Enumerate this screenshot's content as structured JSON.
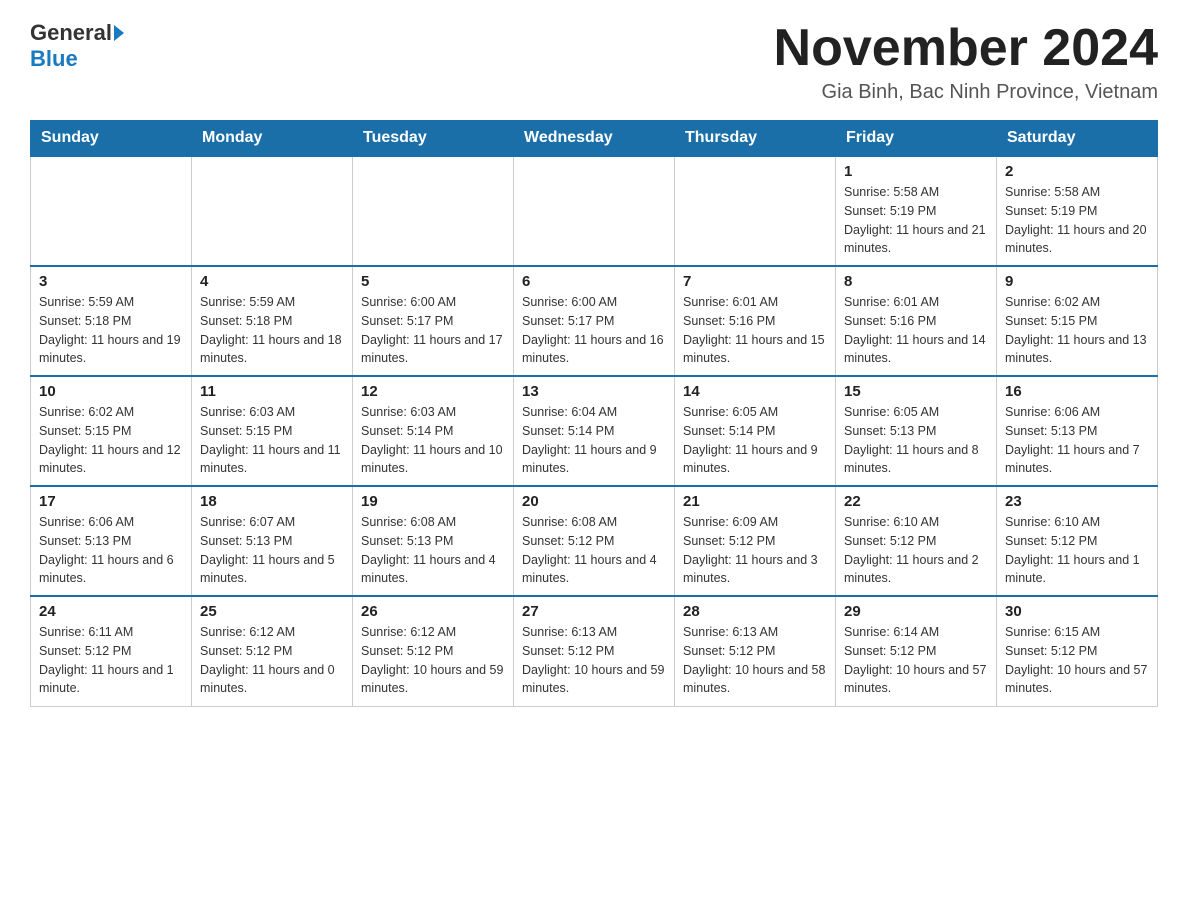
{
  "header": {
    "logo_general": "General",
    "logo_blue": "Blue",
    "month_title": "November 2024",
    "location": "Gia Binh, Bac Ninh Province, Vietnam"
  },
  "days_of_week": [
    "Sunday",
    "Monday",
    "Tuesday",
    "Wednesday",
    "Thursday",
    "Friday",
    "Saturday"
  ],
  "weeks": [
    {
      "days": [
        {
          "number": "",
          "info": ""
        },
        {
          "number": "",
          "info": ""
        },
        {
          "number": "",
          "info": ""
        },
        {
          "number": "",
          "info": ""
        },
        {
          "number": "",
          "info": ""
        },
        {
          "number": "1",
          "info": "Sunrise: 5:58 AM\nSunset: 5:19 PM\nDaylight: 11 hours and 21 minutes."
        },
        {
          "number": "2",
          "info": "Sunrise: 5:58 AM\nSunset: 5:19 PM\nDaylight: 11 hours and 20 minutes."
        }
      ]
    },
    {
      "days": [
        {
          "number": "3",
          "info": "Sunrise: 5:59 AM\nSunset: 5:18 PM\nDaylight: 11 hours and 19 minutes."
        },
        {
          "number": "4",
          "info": "Sunrise: 5:59 AM\nSunset: 5:18 PM\nDaylight: 11 hours and 18 minutes."
        },
        {
          "number": "5",
          "info": "Sunrise: 6:00 AM\nSunset: 5:17 PM\nDaylight: 11 hours and 17 minutes."
        },
        {
          "number": "6",
          "info": "Sunrise: 6:00 AM\nSunset: 5:17 PM\nDaylight: 11 hours and 16 minutes."
        },
        {
          "number": "7",
          "info": "Sunrise: 6:01 AM\nSunset: 5:16 PM\nDaylight: 11 hours and 15 minutes."
        },
        {
          "number": "8",
          "info": "Sunrise: 6:01 AM\nSunset: 5:16 PM\nDaylight: 11 hours and 14 minutes."
        },
        {
          "number": "9",
          "info": "Sunrise: 6:02 AM\nSunset: 5:15 PM\nDaylight: 11 hours and 13 minutes."
        }
      ]
    },
    {
      "days": [
        {
          "number": "10",
          "info": "Sunrise: 6:02 AM\nSunset: 5:15 PM\nDaylight: 11 hours and 12 minutes."
        },
        {
          "number": "11",
          "info": "Sunrise: 6:03 AM\nSunset: 5:15 PM\nDaylight: 11 hours and 11 minutes."
        },
        {
          "number": "12",
          "info": "Sunrise: 6:03 AM\nSunset: 5:14 PM\nDaylight: 11 hours and 10 minutes."
        },
        {
          "number": "13",
          "info": "Sunrise: 6:04 AM\nSunset: 5:14 PM\nDaylight: 11 hours and 9 minutes."
        },
        {
          "number": "14",
          "info": "Sunrise: 6:05 AM\nSunset: 5:14 PM\nDaylight: 11 hours and 9 minutes."
        },
        {
          "number": "15",
          "info": "Sunrise: 6:05 AM\nSunset: 5:13 PM\nDaylight: 11 hours and 8 minutes."
        },
        {
          "number": "16",
          "info": "Sunrise: 6:06 AM\nSunset: 5:13 PM\nDaylight: 11 hours and 7 minutes."
        }
      ]
    },
    {
      "days": [
        {
          "number": "17",
          "info": "Sunrise: 6:06 AM\nSunset: 5:13 PM\nDaylight: 11 hours and 6 minutes."
        },
        {
          "number": "18",
          "info": "Sunrise: 6:07 AM\nSunset: 5:13 PM\nDaylight: 11 hours and 5 minutes."
        },
        {
          "number": "19",
          "info": "Sunrise: 6:08 AM\nSunset: 5:13 PM\nDaylight: 11 hours and 4 minutes."
        },
        {
          "number": "20",
          "info": "Sunrise: 6:08 AM\nSunset: 5:12 PM\nDaylight: 11 hours and 4 minutes."
        },
        {
          "number": "21",
          "info": "Sunrise: 6:09 AM\nSunset: 5:12 PM\nDaylight: 11 hours and 3 minutes."
        },
        {
          "number": "22",
          "info": "Sunrise: 6:10 AM\nSunset: 5:12 PM\nDaylight: 11 hours and 2 minutes."
        },
        {
          "number": "23",
          "info": "Sunrise: 6:10 AM\nSunset: 5:12 PM\nDaylight: 11 hours and 1 minute."
        }
      ]
    },
    {
      "days": [
        {
          "number": "24",
          "info": "Sunrise: 6:11 AM\nSunset: 5:12 PM\nDaylight: 11 hours and 1 minute."
        },
        {
          "number": "25",
          "info": "Sunrise: 6:12 AM\nSunset: 5:12 PM\nDaylight: 11 hours and 0 minutes."
        },
        {
          "number": "26",
          "info": "Sunrise: 6:12 AM\nSunset: 5:12 PM\nDaylight: 10 hours and 59 minutes."
        },
        {
          "number": "27",
          "info": "Sunrise: 6:13 AM\nSunset: 5:12 PM\nDaylight: 10 hours and 59 minutes."
        },
        {
          "number": "28",
          "info": "Sunrise: 6:13 AM\nSunset: 5:12 PM\nDaylight: 10 hours and 58 minutes."
        },
        {
          "number": "29",
          "info": "Sunrise: 6:14 AM\nSunset: 5:12 PM\nDaylight: 10 hours and 57 minutes."
        },
        {
          "number": "30",
          "info": "Sunrise: 6:15 AM\nSunset: 5:12 PM\nDaylight: 10 hours and 57 minutes."
        }
      ]
    }
  ]
}
